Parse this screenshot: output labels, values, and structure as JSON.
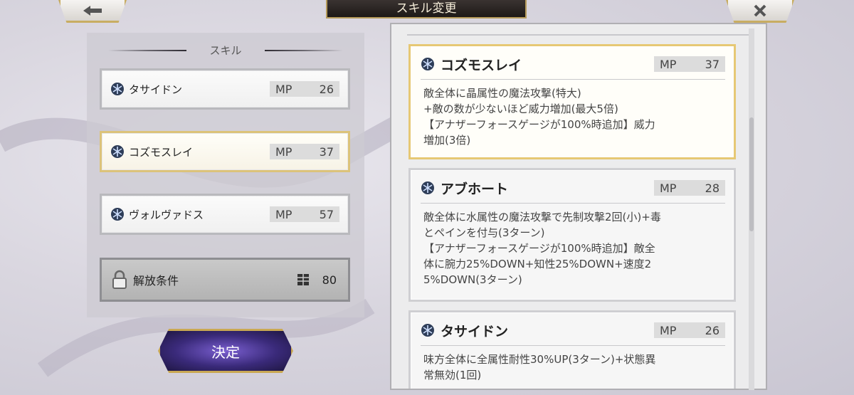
{
  "header": {
    "title": "スキル変更"
  },
  "left": {
    "heading": "スキル",
    "skills": [
      {
        "name": "タサイドン",
        "mp_label": "MP",
        "mp": "26"
      },
      {
        "name": "コズモスレイ",
        "mp_label": "MP",
        "mp": "37"
      },
      {
        "name": "ヴォルヴァドス",
        "mp_label": "MP",
        "mp": "57"
      }
    ],
    "unlock": {
      "label": "解放条件",
      "cost": "80"
    },
    "confirm_label": "決定"
  },
  "details": [
    {
      "name": "コズモスレイ",
      "mp_label": "MP",
      "mp": "37",
      "desc": "敵全体に晶属性の魔法攻撃(特大)\n+敵の数が少ないほど威力増加(最大5倍)\n【アナザーフォースゲージが100%時追加】威力\n増加(3倍)"
    },
    {
      "name": "アブホート",
      "mp_label": "MP",
      "mp": "28",
      "desc": "敵全体に水属性の魔法攻撃で先制攻撃2回(小)+毒\nとペインを付与(3ターン)\n【アナザーフォースゲージが100%時追加】敵全\n体に腕力25%DOWN+知性25%DOWN+速度2\n5%DOWN(3ターン)"
    },
    {
      "name": "タサイドン",
      "mp_label": "MP",
      "mp": "26",
      "desc": "味方全体に全属性耐性30%UP(3ターン)+状態異\n常無効(1回)"
    }
  ],
  "colors": {
    "selected_border": "#dcc37a",
    "confirm_bg": "#3a2a7a"
  },
  "icons": {
    "skill": "crystal-snowflake-icon",
    "lock": "padlock-icon",
    "cost": "wrapped-cube-icon",
    "back": "back-arrow-icon",
    "close": "close-icon"
  }
}
